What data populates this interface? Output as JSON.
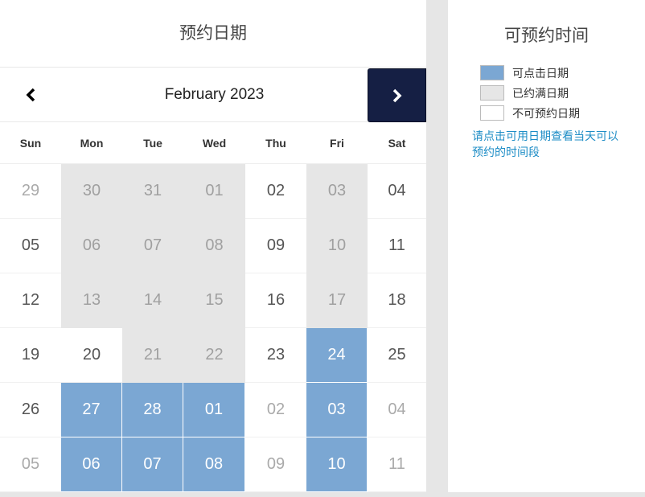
{
  "calendar": {
    "title": "预约日期",
    "month_label": "February 2023",
    "prev_icon": "chevron-left-icon",
    "next_icon": "chevron-right-icon",
    "weekdays": [
      "Sun",
      "Mon",
      "Tue",
      "Wed",
      "Thu",
      "Fri",
      "Sat"
    ],
    "weeks": [
      [
        {
          "d": "29",
          "s": "na",
          "o": true
        },
        {
          "d": "30",
          "s": "full"
        },
        {
          "d": "31",
          "s": "full"
        },
        {
          "d": "01",
          "s": "full"
        },
        {
          "d": "02",
          "s": "na"
        },
        {
          "d": "03",
          "s": "full"
        },
        {
          "d": "04",
          "s": "na"
        }
      ],
      [
        {
          "d": "05",
          "s": "na"
        },
        {
          "d": "06",
          "s": "full"
        },
        {
          "d": "07",
          "s": "full"
        },
        {
          "d": "08",
          "s": "full"
        },
        {
          "d": "09",
          "s": "na"
        },
        {
          "d": "10",
          "s": "full"
        },
        {
          "d": "11",
          "s": "na"
        }
      ],
      [
        {
          "d": "12",
          "s": "na"
        },
        {
          "d": "13",
          "s": "full"
        },
        {
          "d": "14",
          "s": "full"
        },
        {
          "d": "15",
          "s": "full"
        },
        {
          "d": "16",
          "s": "na"
        },
        {
          "d": "17",
          "s": "full"
        },
        {
          "d": "18",
          "s": "na"
        }
      ],
      [
        {
          "d": "19",
          "s": "na"
        },
        {
          "d": "20",
          "s": "na"
        },
        {
          "d": "21",
          "s": "full"
        },
        {
          "d": "22",
          "s": "full"
        },
        {
          "d": "23",
          "s": "na"
        },
        {
          "d": "24",
          "s": "avail"
        },
        {
          "d": "25",
          "s": "na"
        }
      ],
      [
        {
          "d": "26",
          "s": "na"
        },
        {
          "d": "27",
          "s": "avail"
        },
        {
          "d": "28",
          "s": "avail"
        },
        {
          "d": "01",
          "s": "avail"
        },
        {
          "d": "02",
          "s": "na",
          "o": true
        },
        {
          "d": "03",
          "s": "avail"
        },
        {
          "d": "04",
          "s": "na",
          "o": true
        }
      ],
      [
        {
          "d": "05",
          "s": "na",
          "o": true
        },
        {
          "d": "06",
          "s": "avail"
        },
        {
          "d": "07",
          "s": "avail"
        },
        {
          "d": "08",
          "s": "avail"
        },
        {
          "d": "09",
          "s": "na",
          "o": true
        },
        {
          "d": "10",
          "s": "avail"
        },
        {
          "d": "11",
          "s": "na",
          "o": true
        }
      ]
    ]
  },
  "sidebar": {
    "title": "可预约时间",
    "legend": [
      {
        "label": "可点击日期",
        "color": "#7ba7d3"
      },
      {
        "label": "已约满日期",
        "color": "#e6e6e6"
      },
      {
        "label": "不可预约日期",
        "color": "#ffffff"
      }
    ],
    "info": "请点击可用日期查看当天可以预约的时间段"
  },
  "colors": {
    "available": "#7ba7d3",
    "full": "#e6e6e6",
    "nav_active": "#151f44",
    "info_text": "#1e8dc6"
  }
}
